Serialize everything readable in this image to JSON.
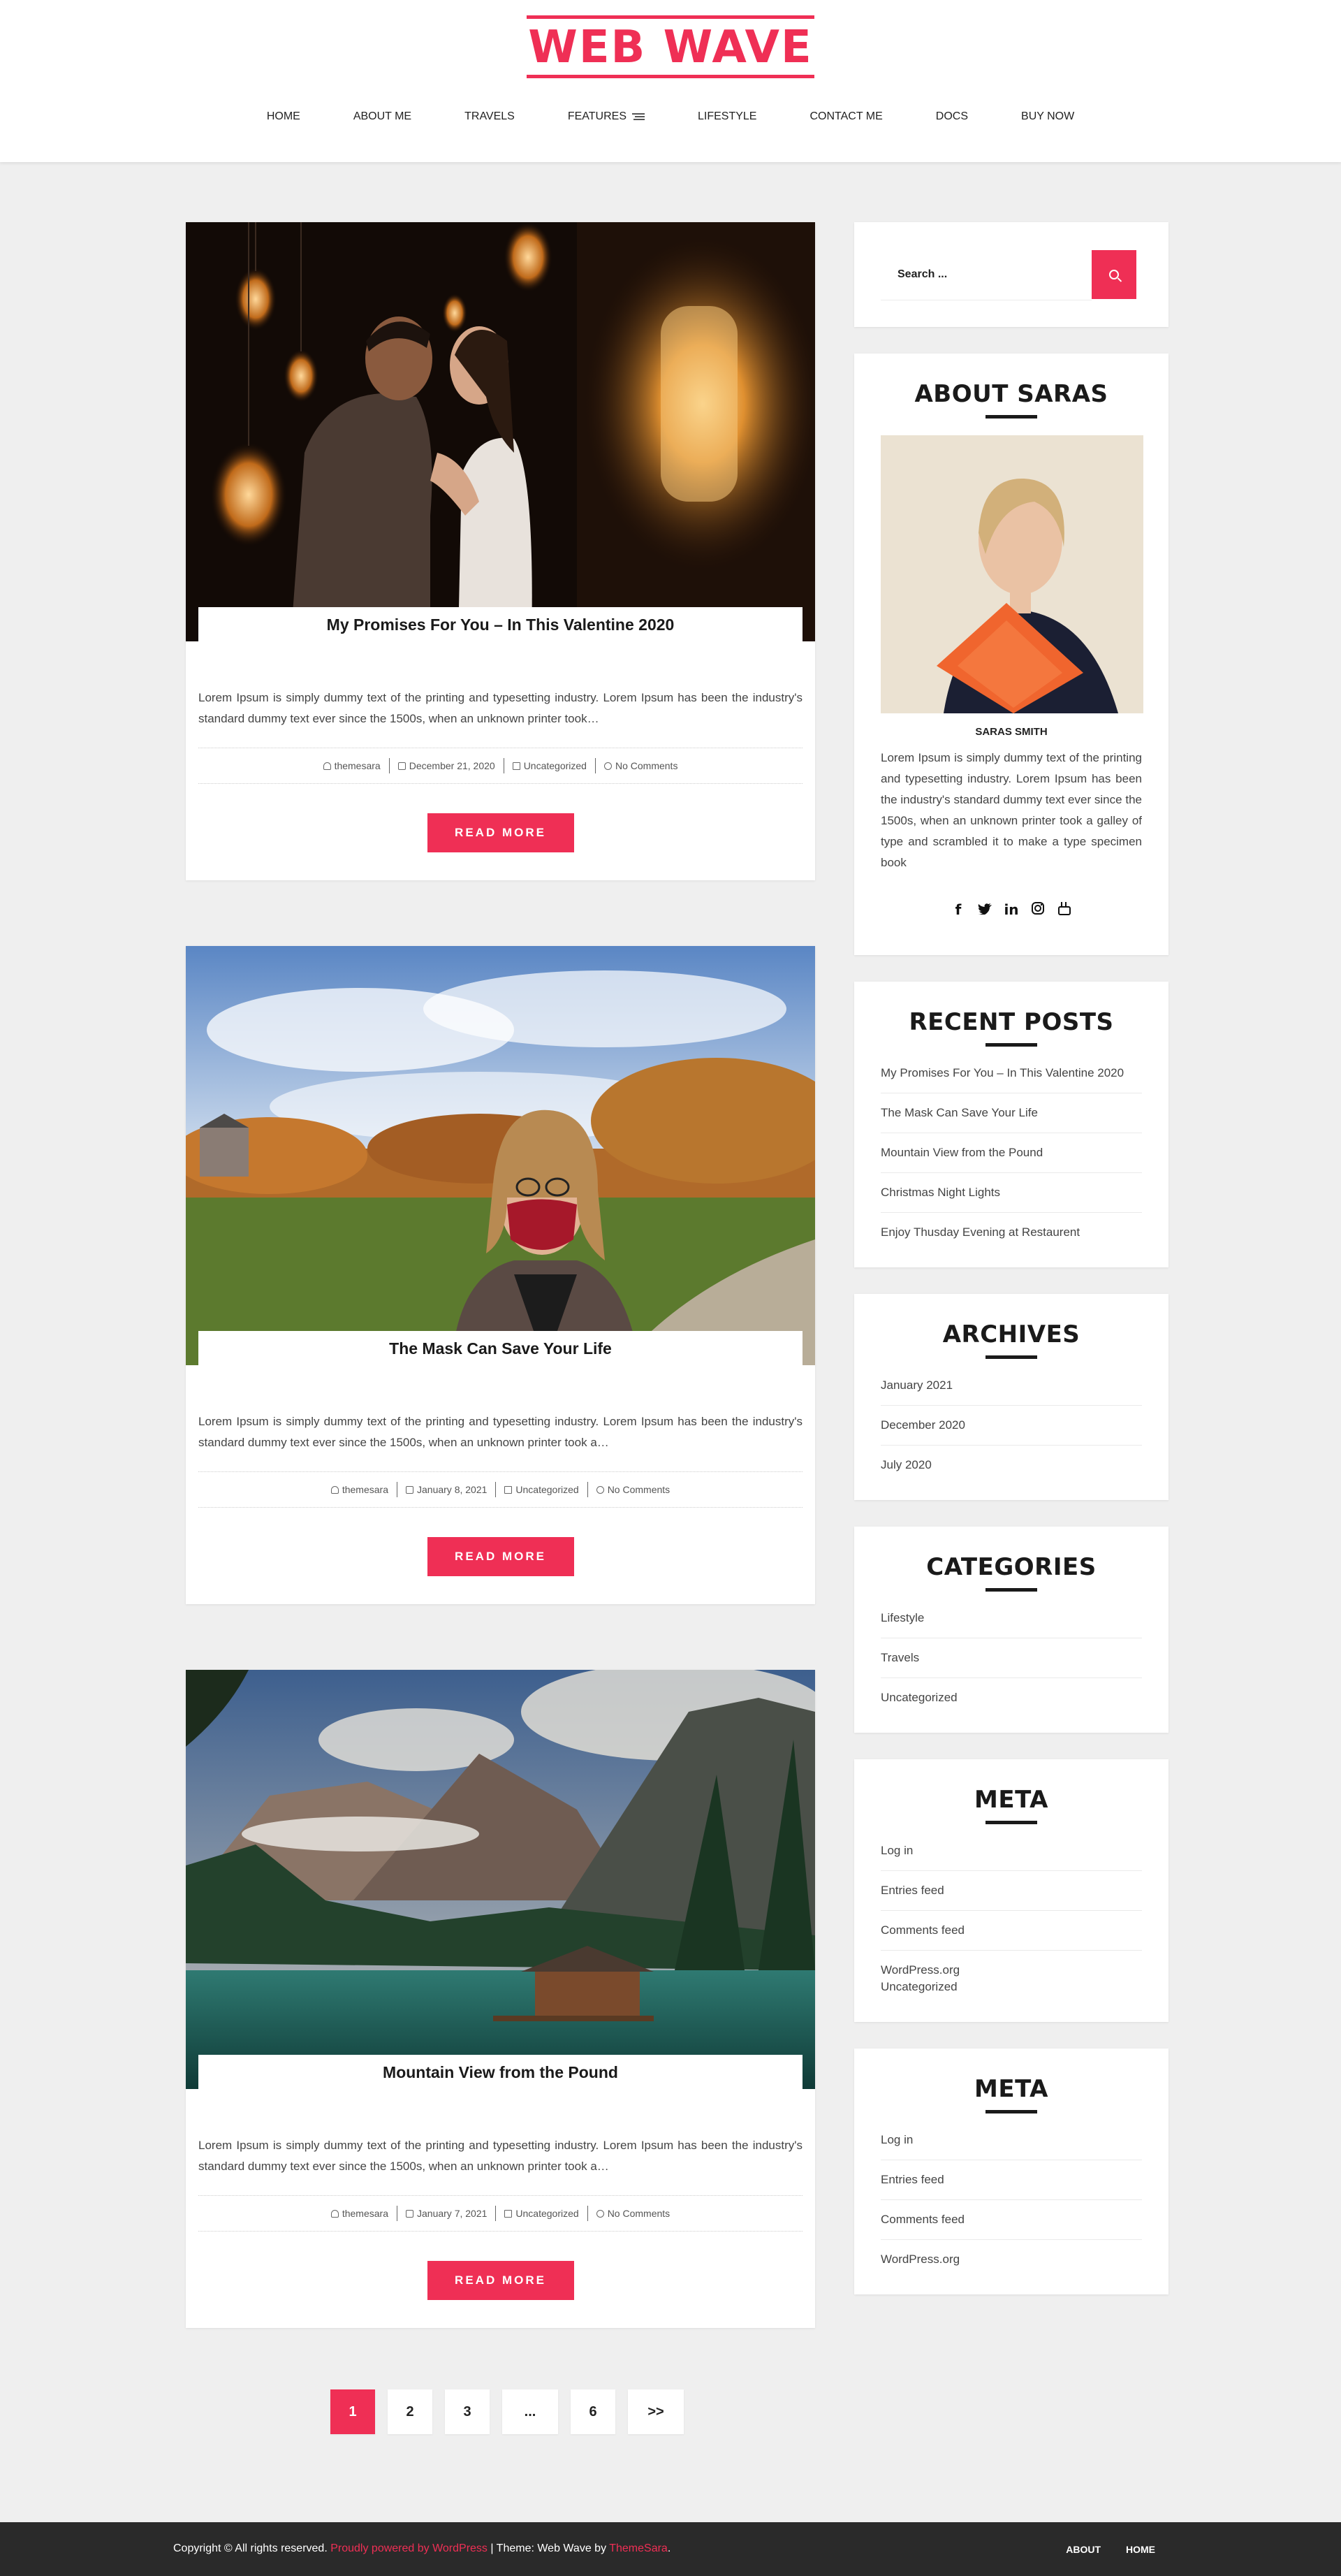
{
  "site": {
    "logo": "WEB WAVE"
  },
  "nav": [
    "HOME",
    "ABOUT ME",
    "TRAVELS",
    "FEATURES",
    "LIFESTYLE",
    "CONTACT ME",
    "DOCS",
    "BUY NOW"
  ],
  "posts": [
    {
      "title": "My Promises For You – In This Valentine 2020",
      "excerpt": "Lorem Ipsum is simply dummy text of the printing and typesetting industry. Lorem Ipsum has been the industry's standard dummy text ever since the 1500s, when an unknown printer took…",
      "author": "themesara",
      "date": "December 21, 2020",
      "category": "Uncategorized",
      "comments": "No Comments",
      "button": "READ MORE"
    },
    {
      "title": "The Mask Can Save Your Life",
      "excerpt": "Lorem Ipsum is simply dummy text of the printing and typesetting industry. Lorem Ipsum has been the industry's standard dummy text ever since the 1500s, when an unknown printer took a…",
      "author": "themesara",
      "date": "January 8, 2021",
      "category": "Uncategorized",
      "comments": "No Comments",
      "button": "READ MORE"
    },
    {
      "title": "Mountain View from the Pound",
      "excerpt": "Lorem Ipsum is simply dummy text of the printing and typesetting industry. Lorem Ipsum has been the industry's standard dummy text ever since the 1500s, when an unknown printer took a…",
      "author": "themesara",
      "date": "January 7, 2021",
      "category": "Uncategorized",
      "comments": "No Comments",
      "button": "READ MORE"
    }
  ],
  "pagination": [
    "1",
    "2",
    "3",
    "...",
    "6",
    ">>"
  ],
  "sidebar": {
    "search": {
      "placeholder": "Search ..."
    },
    "about": {
      "title": "ABOUT SARAS",
      "name": "SARAS SMITH",
      "text": "Lorem Ipsum is simply dummy text of the printing and typesetting industry. Lorem Ipsum has been the industry's standard dummy text ever since the 1500s, when an unknown printer took a galley of type and scrambled it to make a type specimen book",
      "social": [
        "f",
        "t",
        "in",
        "ig",
        "yt"
      ]
    },
    "recent": {
      "title": "RECENT POSTS",
      "items": [
        "My Promises For You – In This Valentine 2020",
        "The Mask Can Save Your Life",
        "Mountain View from the Pound",
        "Christmas Night Lights",
        "Enjoy Thusday Evening at Restaurent"
      ]
    },
    "archives": {
      "title": "ARCHIVES",
      "items": [
        "January 2021",
        "December 2020",
        "July 2020"
      ]
    },
    "categories": {
      "title": "CATEGORIES",
      "items": [
        "Lifestyle",
        "Travels",
        "Uncategorized"
      ]
    },
    "meta1": {
      "title": "META",
      "items": [
        "Log in",
        "Entries feed",
        "Comments feed",
        "WordPress.org",
        "Uncategorized"
      ]
    },
    "meta2": {
      "title": "META",
      "items": [
        "Log in",
        "Entries feed",
        "Comments feed",
        "WordPress.org"
      ]
    }
  },
  "footer": {
    "copyright": "Copyright © All rights reserved.",
    "powered": "Proudly powered by WordPress",
    "theme": " | Theme: Web Wave by ",
    "author": "ThemeSara",
    "end": ".",
    "links": [
      "ABOUT",
      "HOME"
    ]
  },
  "colors": {
    "accent": "#ef2f55",
    "footer": "#2a2a2a",
    "background": "#efefef"
  }
}
